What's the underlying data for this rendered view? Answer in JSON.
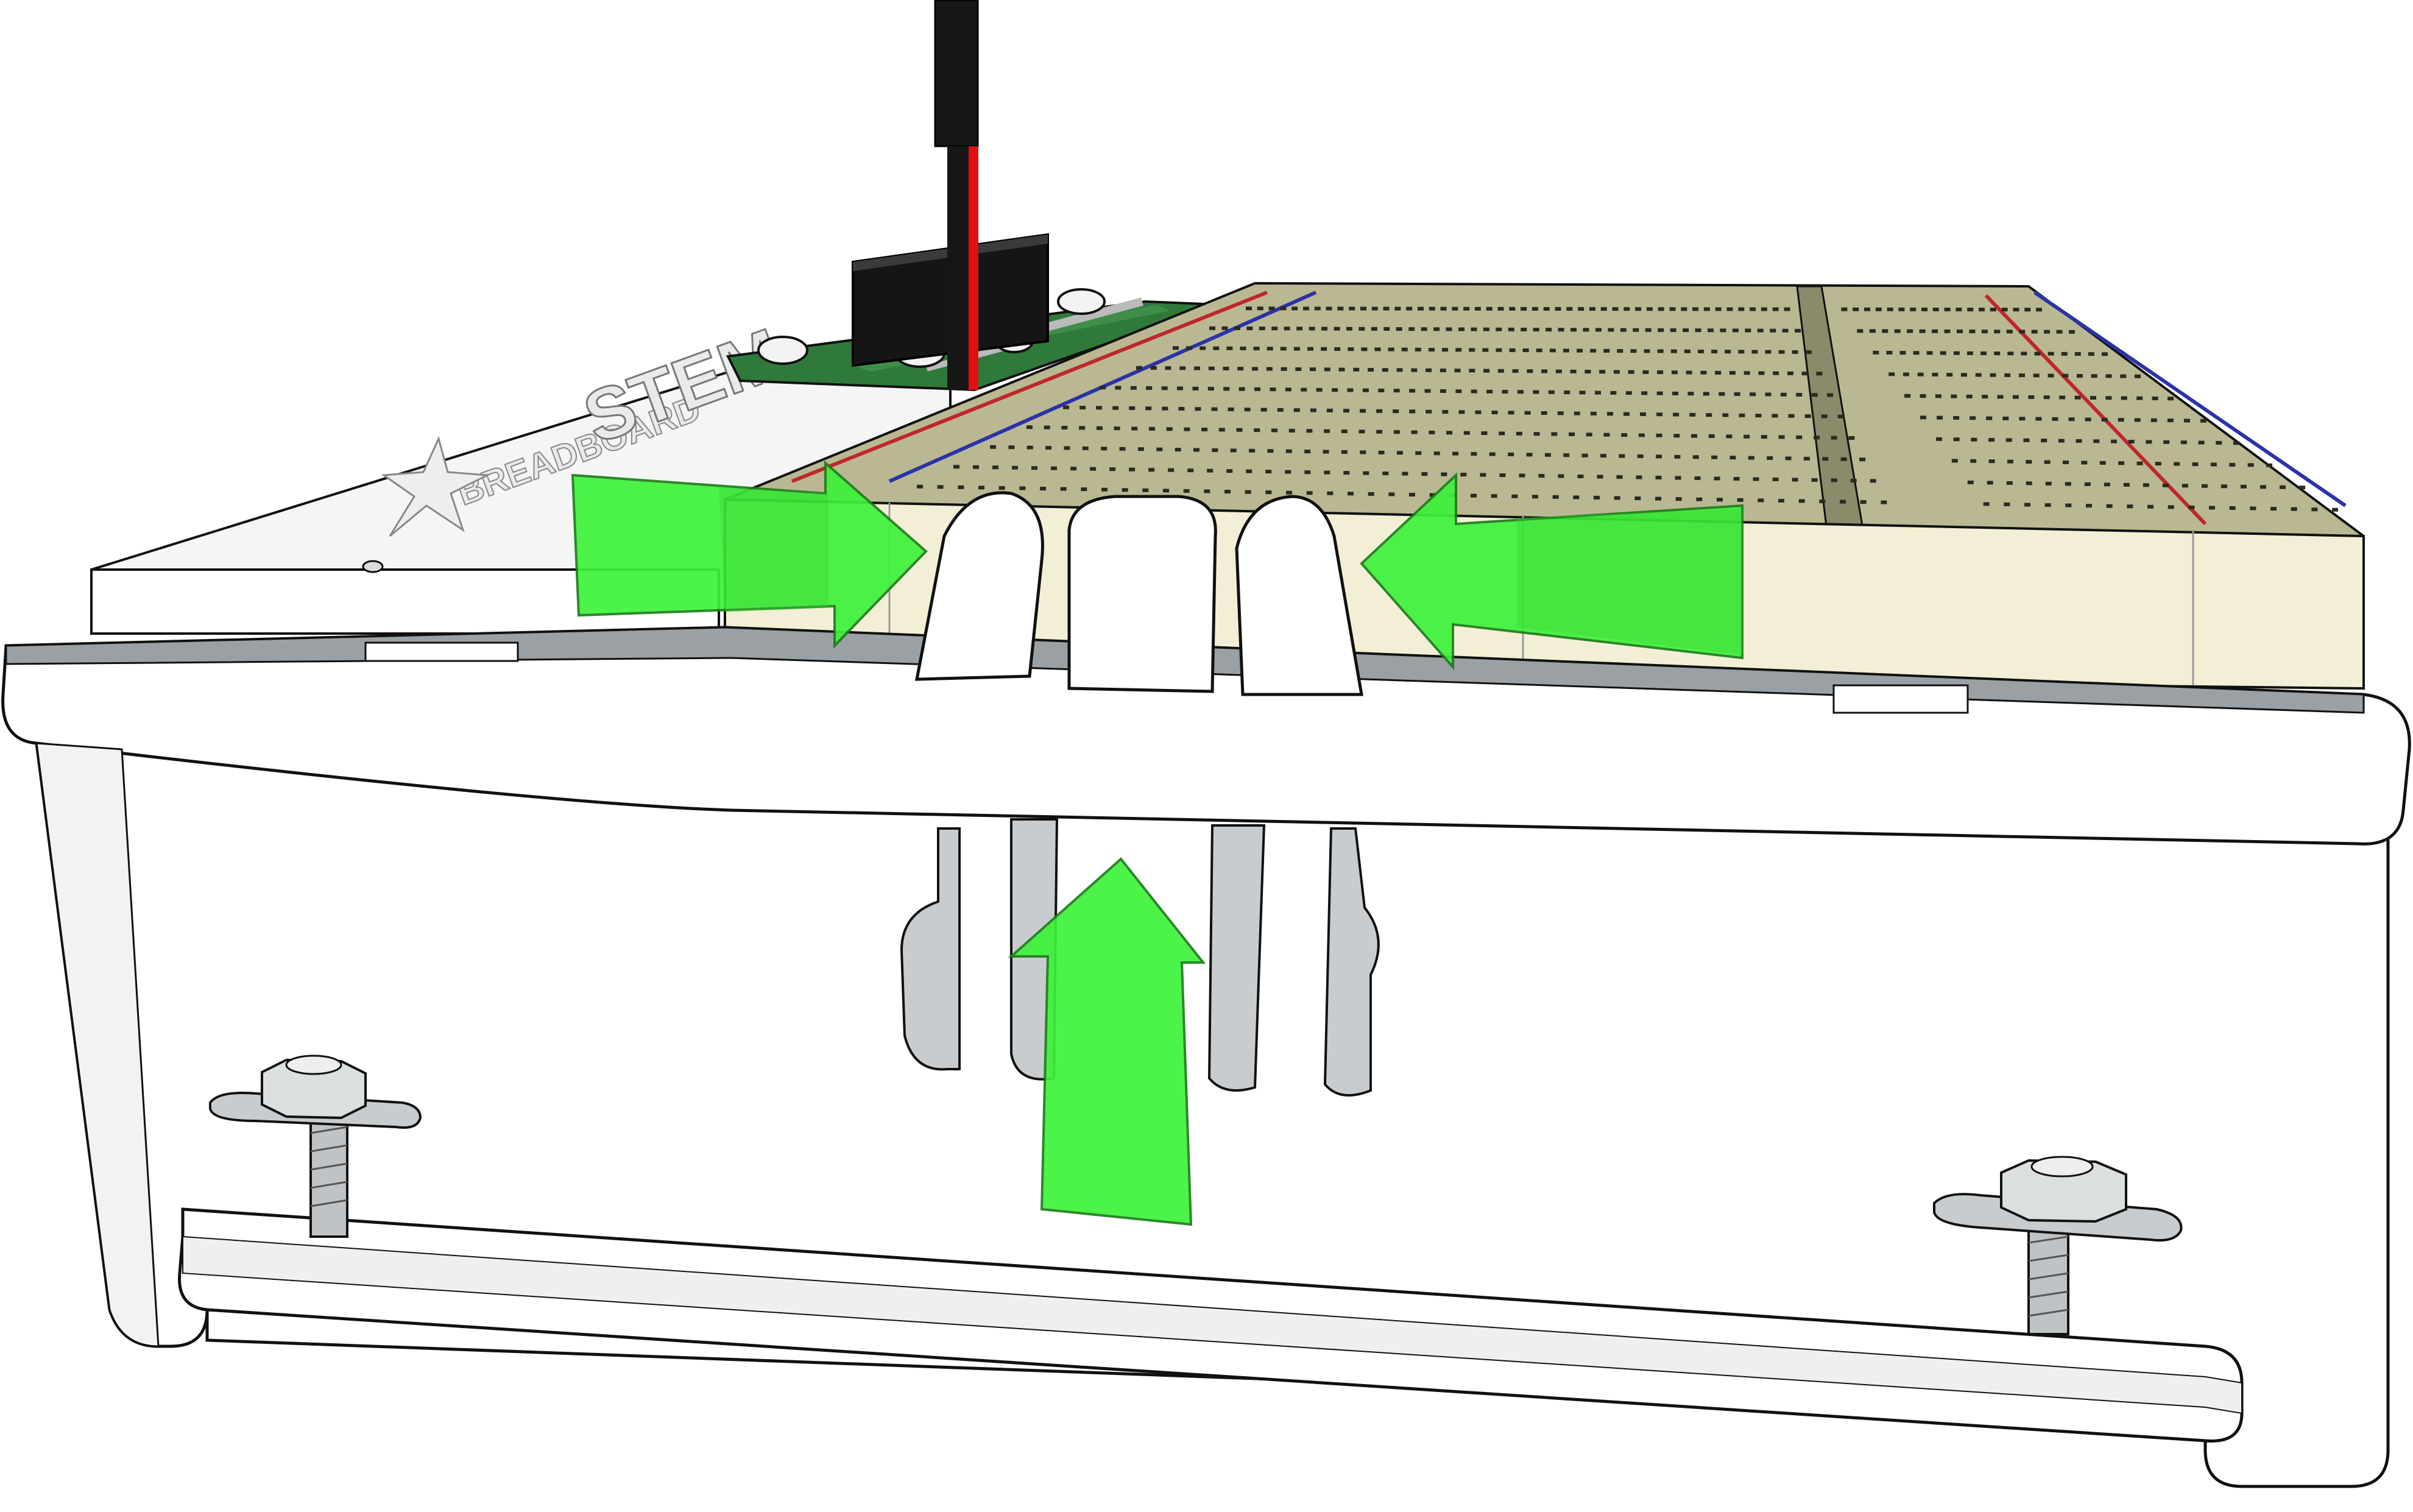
{
  "figure": {
    "description_visible_text": "",
    "logo": {
      "line1": "BREADBOARD",
      "line2": "STEM"
    },
    "colors": {
      "outline": "#111111",
      "case_body": "#ffffff",
      "case_shadow": "#9aa0a3",
      "case_mid": "#c8ccce",
      "breadboard": "#b9b892",
      "breadboard_light": "#d9d8b6",
      "breadboard_front": "#f3efd6",
      "rail_red": "#c0262b",
      "rail_blue": "#2a33a8",
      "arrow_green": "#3df23a",
      "arrow_green_shade": "#2fd02c",
      "pcb_green": "#2f7a3a",
      "header_black": "#151515",
      "wire_red": "#e01010",
      "metal": "#bfc3c5"
    },
    "icons": [
      "arrow-right-icon",
      "arrow-left-icon",
      "arrow-up-icon"
    ]
  }
}
